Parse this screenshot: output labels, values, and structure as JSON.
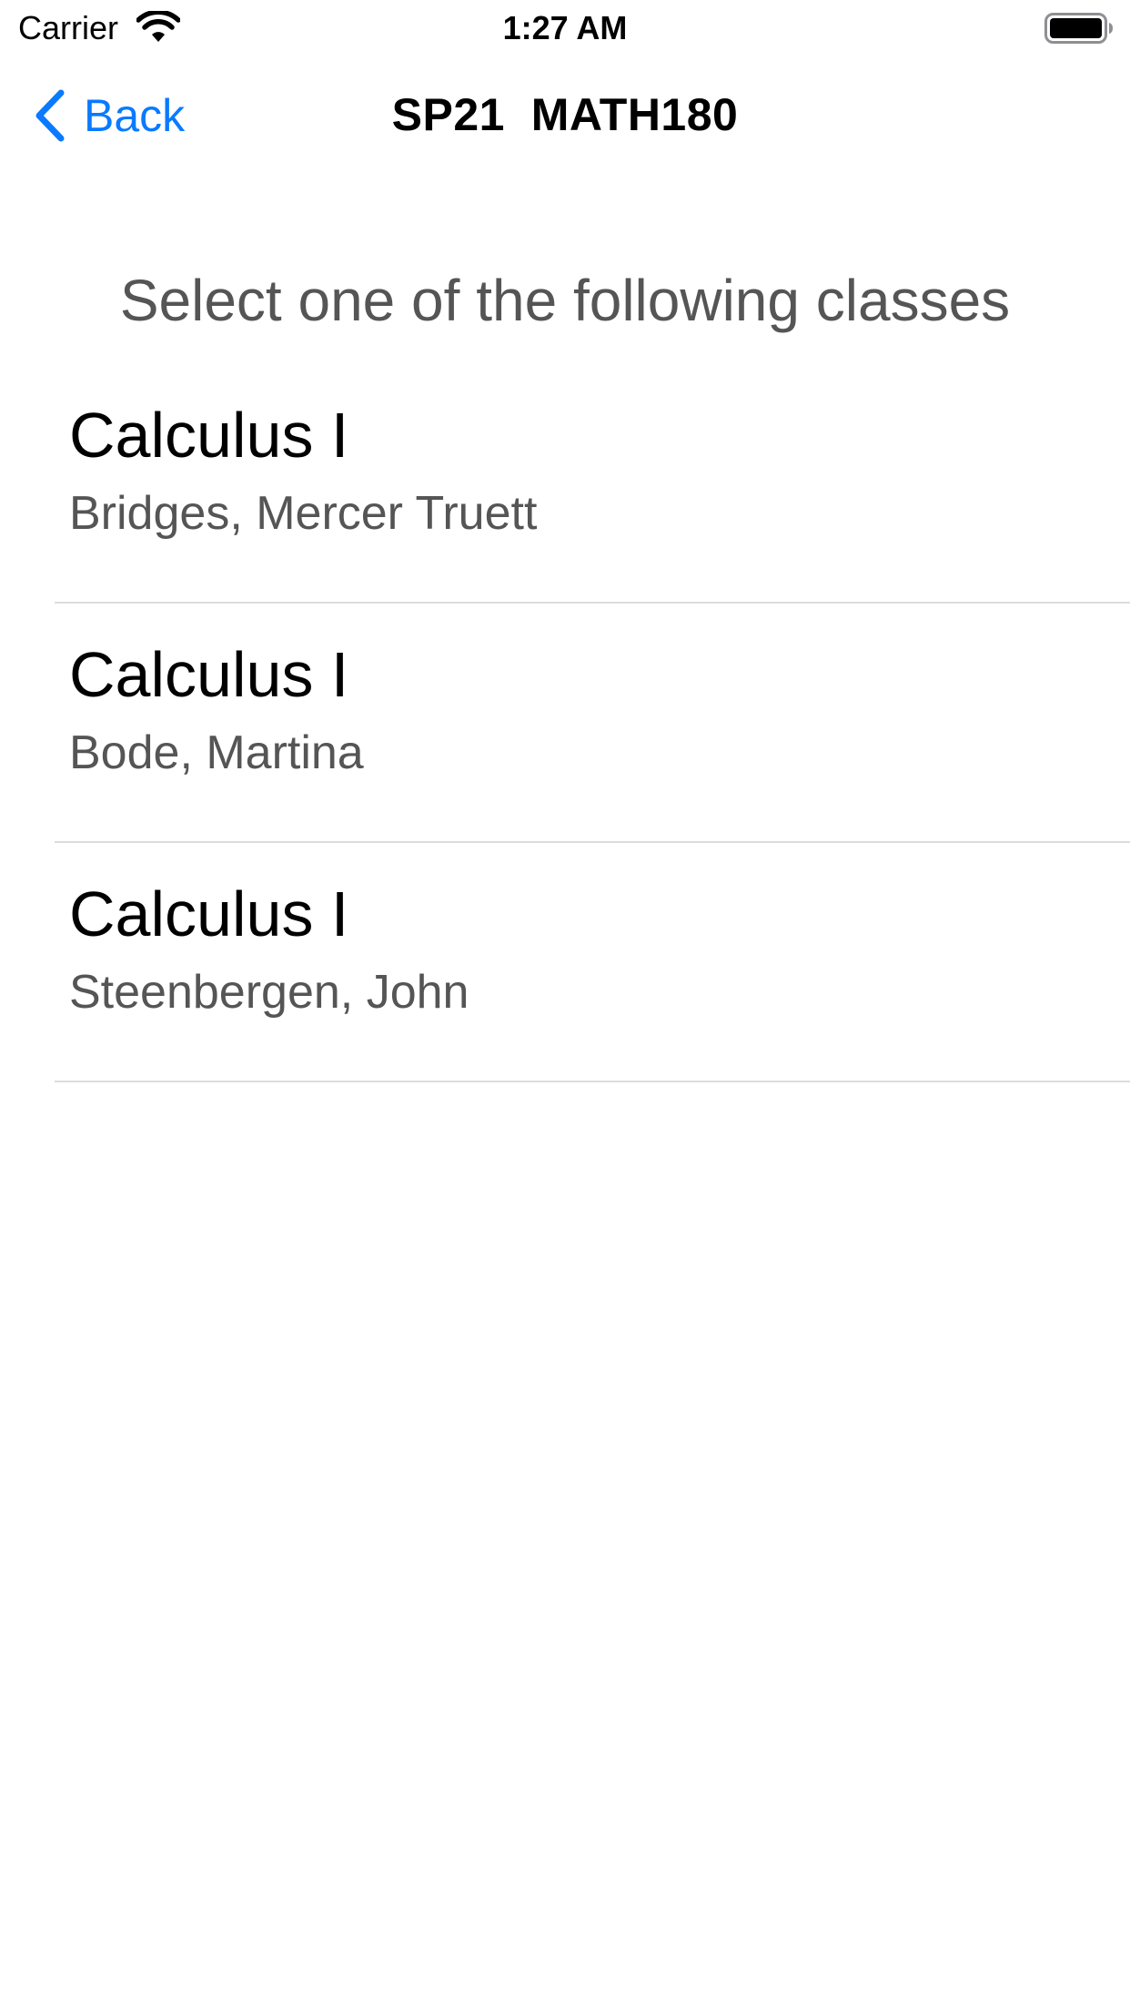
{
  "status_bar": {
    "carrier": "Carrier",
    "time": "1:27 AM",
    "wifi_icon": "wifi-icon",
    "battery_icon": "battery-icon"
  },
  "nav": {
    "back_label": "Back",
    "back_icon": "chevron-left-icon",
    "title": "SP21  MATH180",
    "accent_color": "#0a7aff"
  },
  "prompt": "Select one of the following classes",
  "classes": [
    {
      "title": "Calculus I",
      "instructor": "Bridges, Mercer Truett"
    },
    {
      "title": "Calculus I",
      "instructor": "Bode, Martina"
    },
    {
      "title": "Calculus I",
      "instructor": "Steenbergen, John"
    }
  ]
}
